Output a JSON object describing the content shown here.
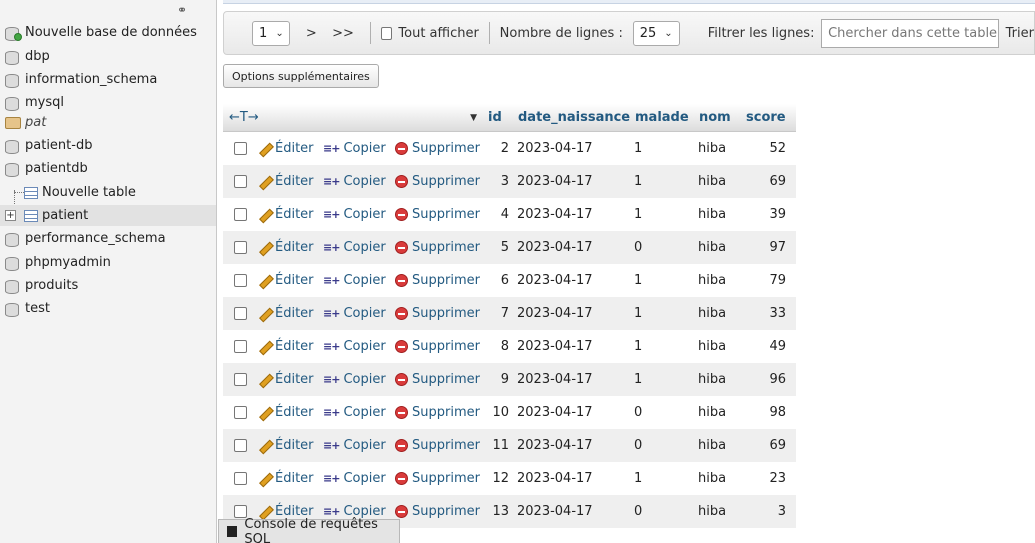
{
  "nav": {
    "items": [
      {
        "label": "Nouvelle base de données"
      },
      {
        "label": "dbp"
      },
      {
        "label": "information_schema"
      },
      {
        "label": "mysql"
      },
      {
        "label": "pat"
      },
      {
        "label": "patient-db"
      },
      {
        "label": "patientdb"
      },
      {
        "label": "Nouvelle table"
      },
      {
        "label": "patient"
      },
      {
        "label": "performance_schema"
      },
      {
        "label": "phpmyadmin"
      },
      {
        "label": "produits"
      },
      {
        "label": "test"
      }
    ]
  },
  "toolbar": {
    "page_value": "1",
    "next_label": ">",
    "last_label": ">>",
    "show_all_label": "Tout afficher",
    "rows_label": "Nombre de lignes :",
    "rows_value": "25",
    "filter_label": "Filtrer les lignes:",
    "filter_placeholder": "Chercher dans cette table",
    "sort_label": "Trier"
  },
  "options_button": "Options supplémentaires",
  "table": {
    "arrows_label": "←T→",
    "columns": [
      "id",
      "date_naissance",
      "malade",
      "nom",
      "score"
    ],
    "actions": {
      "edit": "Éditer",
      "copy": "Copier",
      "delete": "Supprimer"
    },
    "rows": [
      {
        "id": "2",
        "date_naissance": "2023-04-17",
        "malade": "1",
        "nom": "hiba",
        "score": "52"
      },
      {
        "id": "3",
        "date_naissance": "2023-04-17",
        "malade": "1",
        "nom": "hiba",
        "score": "69"
      },
      {
        "id": "4",
        "date_naissance": "2023-04-17",
        "malade": "1",
        "nom": "hiba",
        "score": "39"
      },
      {
        "id": "5",
        "date_naissance": "2023-04-17",
        "malade": "0",
        "nom": "hiba",
        "score": "97"
      },
      {
        "id": "6",
        "date_naissance": "2023-04-17",
        "malade": "1",
        "nom": "hiba",
        "score": "79"
      },
      {
        "id": "7",
        "date_naissance": "2023-04-17",
        "malade": "1",
        "nom": "hiba",
        "score": "33"
      },
      {
        "id": "8",
        "date_naissance": "2023-04-17",
        "malade": "1",
        "nom": "hiba",
        "score": "49"
      },
      {
        "id": "9",
        "date_naissance": "2023-04-17",
        "malade": "1",
        "nom": "hiba",
        "score": "96"
      },
      {
        "id": "10",
        "date_naissance": "2023-04-17",
        "malade": "0",
        "nom": "hiba",
        "score": "98"
      },
      {
        "id": "11",
        "date_naissance": "2023-04-17",
        "malade": "0",
        "nom": "hiba",
        "score": "69"
      },
      {
        "id": "12",
        "date_naissance": "2023-04-17",
        "malade": "1",
        "nom": "hiba",
        "score": "23"
      },
      {
        "id": "13",
        "date_naissance": "2023-04-17",
        "malade": "0",
        "nom": "hiba",
        "score": "3"
      }
    ]
  },
  "console_label": "Console de requêtes SQL",
  "colors": {
    "link": "#235a81",
    "delete": "#d93b3b"
  }
}
